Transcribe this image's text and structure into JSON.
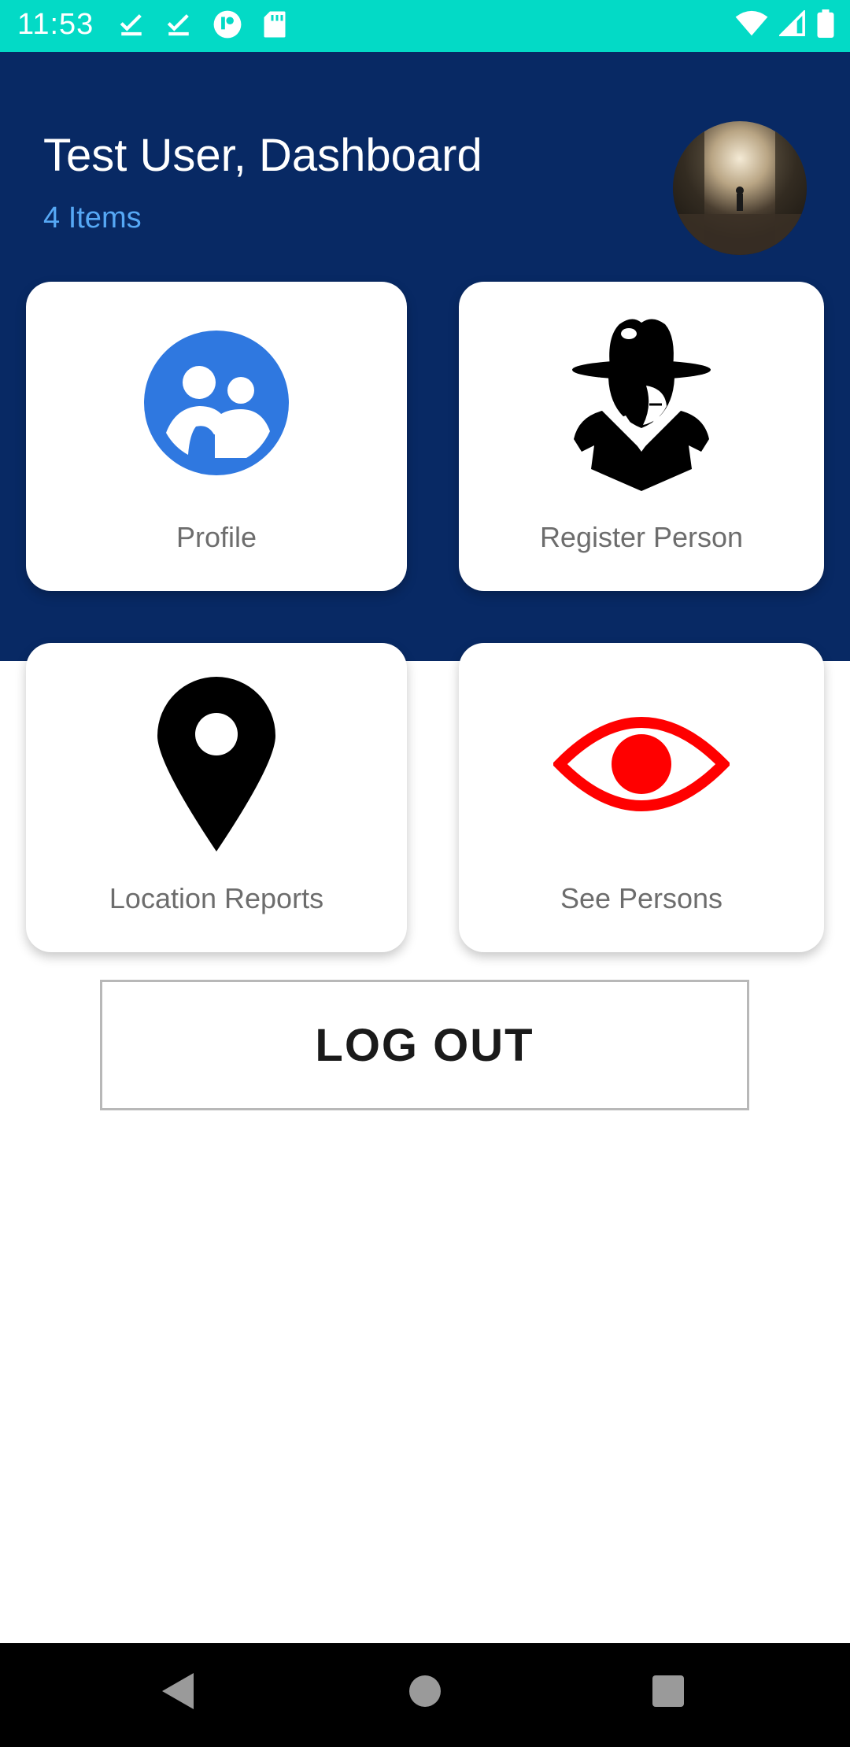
{
  "status_bar": {
    "time": "11:53",
    "left_icons": [
      "download-done-icon",
      "download-done-icon",
      "app-notification-icon",
      "sd-card-icon"
    ],
    "right_icons": [
      "wifi-icon",
      "signal-icon",
      "battery-icon"
    ]
  },
  "header": {
    "title": "Test User, Dashboard",
    "subtitle": "4 Items",
    "background_color": "#082964",
    "subtitle_color": "#56a8f5"
  },
  "cards": [
    {
      "label": "Profile",
      "icon": "group-profile-icon"
    },
    {
      "label": "Register Person",
      "icon": "detective-icon"
    },
    {
      "label": "Location Reports",
      "icon": "location-pin-icon"
    },
    {
      "label": "See Persons",
      "icon": "eye-icon"
    }
  ],
  "logout": {
    "label": "LOG OUT"
  },
  "nav_bar": {
    "icons": [
      "back-icon",
      "home-icon",
      "recents-icon"
    ]
  },
  "colors": {
    "status_bar": "#03dac6",
    "profile_icon": "#2f78e0",
    "eye_icon": "#ff0000"
  }
}
